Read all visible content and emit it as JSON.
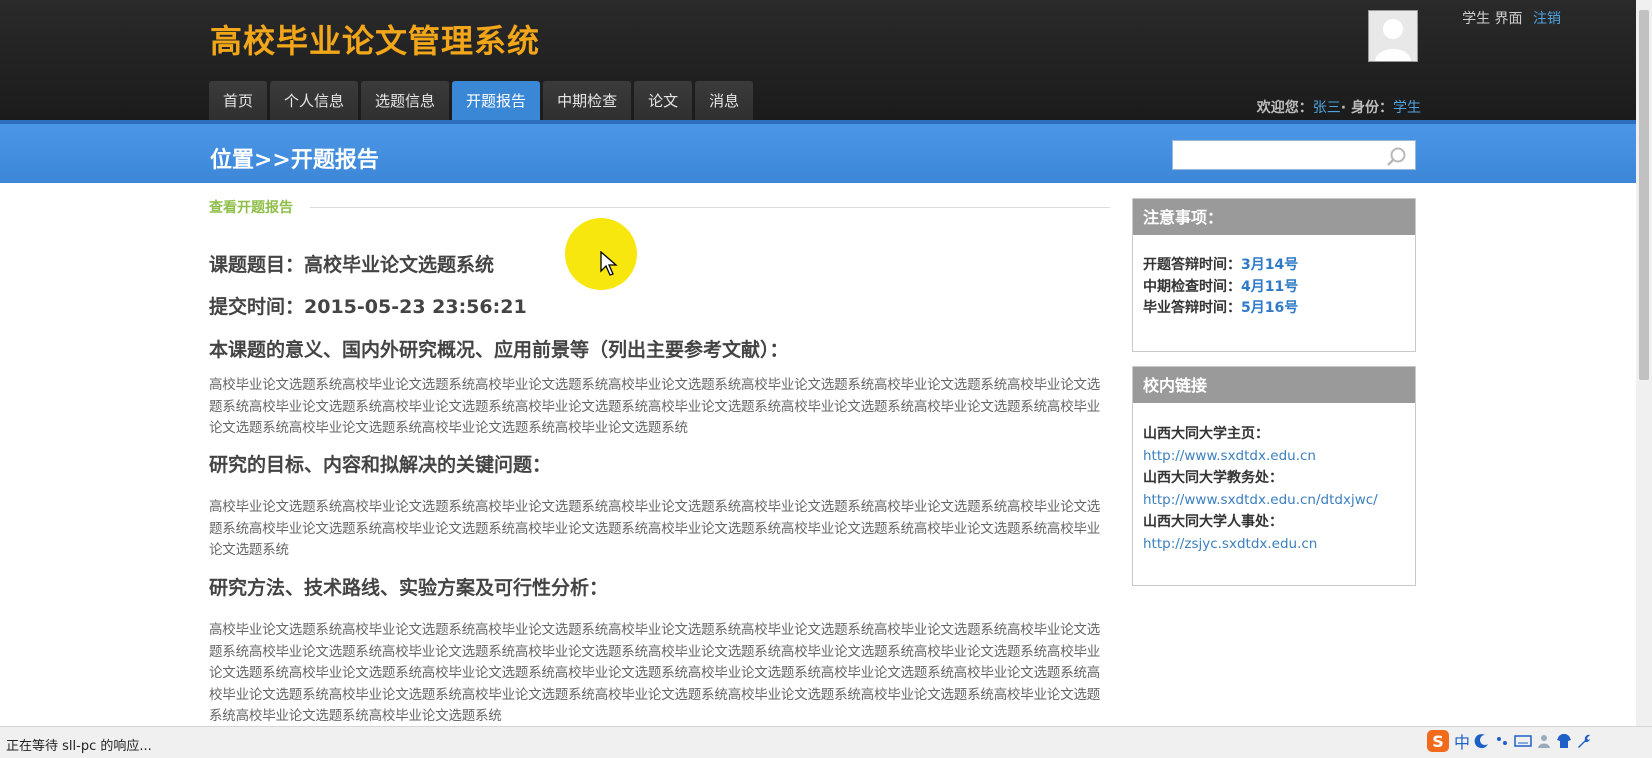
{
  "header": {
    "site_title": "高校毕业论文管理系统",
    "user_mode": "学生 界面",
    "logout": "注销",
    "welcome_label": "欢迎您：",
    "user_name": "张三",
    "role_label": "· 身份：",
    "role_value": "学生"
  },
  "nav": {
    "tabs": [
      {
        "label": "首页"
      },
      {
        "label": "个人信息"
      },
      {
        "label": "选题信息"
      },
      {
        "label": "开题报告"
      },
      {
        "label": "中期检查"
      },
      {
        "label": "论文"
      },
      {
        "label": "消息"
      }
    ],
    "active": "开题报告"
  },
  "bar": {
    "location": "位置>>开题报告",
    "search_placeholder": ""
  },
  "main": {
    "section_link": "查看开题报告",
    "topic": "课题题目：高校毕业论文选题系统",
    "submit_time": "提交时间：2015-05-23 23:56:21",
    "sections": [
      {
        "heading": "本课题的意义、国内外研究概况、应用前景等（列出主要参考文献）：",
        "text": "高校毕业论文选题系统高校毕业论文选题系统高校毕业论文选题系统高校毕业论文选题系统高校毕业论文选题系统高校毕业论文选题系统高校毕业论文选题系统高校毕业论文选题系统高校毕业论文选题系统高校毕业论文选题系统高校毕业论文选题系统高校毕业论文选题系统高校毕业论文选题系统高校毕业论文选题系统高校毕业论文选题系统高校毕业论文选题系统高校毕业论文选题系统"
      },
      {
        "heading": "研究的目标、内容和拟解决的关键问题：",
        "text": "高校毕业论文选题系统高校毕业论文选题系统高校毕业论文选题系统高校毕业论文选题系统高校毕业论文选题系统高校毕业论文选题系统高校毕业论文选题系统高校毕业论文选题系统高校毕业论文选题系统高校毕业论文选题系统高校毕业论文选题系统高校毕业论文选题系统高校毕业论文选题系统高校毕业论文选题系统"
      },
      {
        "heading": "研究方法、技术路线、实验方案及可行性分析：",
        "text": "高校毕业论文选题系统高校毕业论文选题系统高校毕业论文选题系统高校毕业论文选题系统高校毕业论文选题系统高校毕业论文选题系统高校毕业论文选题系统高校毕业论文选题系统高校毕业论文选题系统高校毕业论文选题系统高校毕业论文选题系统高校毕业论文选题系统高校毕业论文选题系统高校毕业论文选题系统高校毕业论文选题系统高校毕业论文选题系统高校毕业论文选题系统高校毕业论文选题系统高校毕业论文选题系统高校毕业论文选题系统高校毕业论文选题系统高校毕业论文选题系统高校毕业论文选题系统高校毕业论文选题系统高校毕业论文选题系统高校毕业论文选题系统高校毕业论文选题系统高校毕业论文选题系统高校毕业论文选题系统"
      }
    ]
  },
  "sidebar": {
    "notice": {
      "title": "注意事项：",
      "rows": [
        {
          "label": "开题答辩时间：",
          "value": "3月14号"
        },
        {
          "label": "中期检查时间：",
          "value": "4月11号"
        },
        {
          "label": "毕业答辩时间：",
          "value": "5月16号"
        }
      ]
    },
    "links": {
      "title": "校内链接",
      "items": [
        {
          "label": "山西大同大学主页：",
          "url": "http://www.sxdtdx.edu.cn"
        },
        {
          "label": "山西大同大学教务处：",
          "url": "http://www.sxdtdx.edu.cn/dtdxjwc/"
        },
        {
          "label": "山西大同大学人事处：",
          "url": "http://zsjyc.sxdtdx.edu.cn"
        }
      ]
    }
  },
  "statusbar": {
    "text": "正在等待 sll-pc 的响应...",
    "ime_label": "中"
  },
  "colors": {
    "accent": "#3a87d6",
    "title_orange": "#f2a619",
    "link_green": "#8fbf4a"
  }
}
